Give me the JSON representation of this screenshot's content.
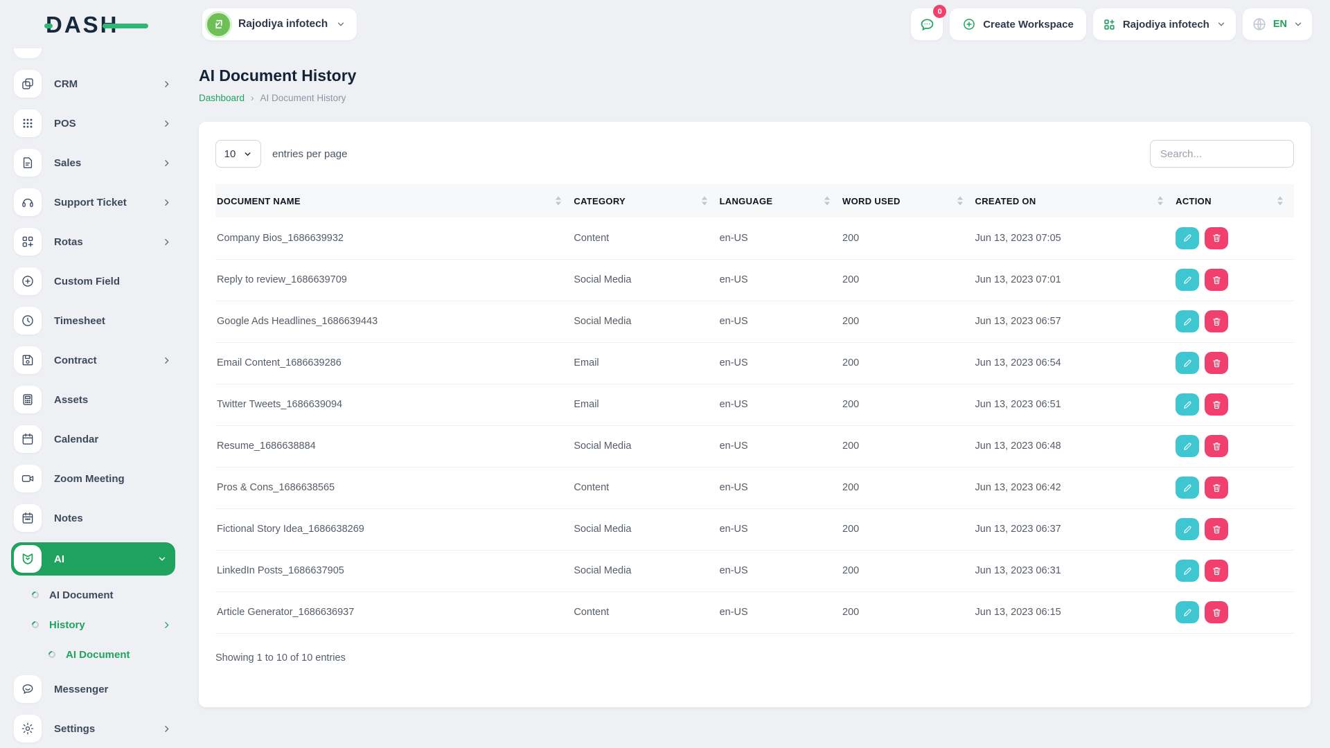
{
  "colors": {
    "primary_green": "#1fa35f",
    "logo_navy": "#16283c",
    "edit_teal": "#3ec7d0",
    "delete_pink": "#f2406e",
    "badge_pink": "#f2406e"
  },
  "topbar": {
    "logo_text": "DASH",
    "workspace_selector": {
      "name": "Rajodiya infotech",
      "icon": "workspace-avatar"
    },
    "messages": {
      "badge_count": "0",
      "icon": "chat-icon"
    },
    "create_workspace": {
      "label": "Create Workspace",
      "icon": "circle-plus-icon"
    },
    "account_selector": {
      "name": "Rajodiya infotech",
      "icon": "grid-plus-icon"
    },
    "language_selector": {
      "code": "EN",
      "icon": "globe-icon"
    }
  },
  "sidebar": {
    "items": [
      {
        "label": "CRM",
        "icon": "crm-icon",
        "has_submenu": true
      },
      {
        "label": "POS",
        "icon": "pos-icon",
        "has_submenu": true
      },
      {
        "label": "Sales",
        "icon": "sales-icon",
        "has_submenu": true
      },
      {
        "label": "Support Ticket",
        "icon": "support-ticket-icon",
        "has_submenu": true
      },
      {
        "label": "Rotas",
        "icon": "rotas-icon",
        "has_submenu": true
      },
      {
        "label": "Custom Field",
        "icon": "custom-field-icon",
        "has_submenu": false
      },
      {
        "label": "Timesheet",
        "icon": "timesheet-icon",
        "has_submenu": false
      },
      {
        "label": "Contract",
        "icon": "contract-icon",
        "has_submenu": true
      },
      {
        "label": "Assets",
        "icon": "assets-icon",
        "has_submenu": false
      },
      {
        "label": "Calendar",
        "icon": "calendar-icon",
        "has_submenu": false
      },
      {
        "label": "Zoom Meeting",
        "icon": "zoom-meeting-icon",
        "has_submenu": false
      },
      {
        "label": "Notes",
        "icon": "notes-icon",
        "has_submenu": false
      },
      {
        "label": "AI",
        "icon": "ai-icon",
        "has_submenu": true,
        "active": true
      },
      {
        "label": "Messenger",
        "icon": "messenger-icon",
        "has_submenu": false
      },
      {
        "label": "Settings",
        "icon": "settings-icon",
        "has_submenu": true
      }
    ],
    "ai_submenu": [
      {
        "label": "AI Document",
        "active": false
      },
      {
        "label": "History",
        "active": true,
        "has_submenu": true
      },
      {
        "label": "AI Document",
        "active": true,
        "nested": true
      }
    ]
  },
  "page": {
    "title": "AI Document History",
    "breadcrumb": {
      "home": "Dashboard",
      "separator": "›",
      "current": "AI Document History"
    }
  },
  "table": {
    "entries_per_page_value": "10",
    "entries_per_page_label": "entries per page",
    "search_placeholder": "Search...",
    "columns": [
      "DOCUMENT NAME",
      "CATEGORY",
      "LANGUAGE",
      "WORD USED",
      "CREATED ON",
      "ACTION"
    ],
    "rows": [
      {
        "name": "Company Bios_1686639932",
        "category": "Content",
        "language": "en-US",
        "words": "200",
        "created": "Jun 13, 2023 07:05"
      },
      {
        "name": "Reply to review_1686639709",
        "category": "Social Media",
        "language": "en-US",
        "words": "200",
        "created": "Jun 13, 2023 07:01"
      },
      {
        "name": "Google Ads Headlines_1686639443",
        "category": "Social Media",
        "language": "en-US",
        "words": "200",
        "created": "Jun 13, 2023 06:57"
      },
      {
        "name": "Email Content_1686639286",
        "category": "Email",
        "language": "en-US",
        "words": "200",
        "created": "Jun 13, 2023 06:54"
      },
      {
        "name": "Twitter Tweets_1686639094",
        "category": "Email",
        "language": "en-US",
        "words": "200",
        "created": "Jun 13, 2023 06:51"
      },
      {
        "name": "Resume_1686638884",
        "category": "Social Media",
        "language": "en-US",
        "words": "200",
        "created": "Jun 13, 2023 06:48"
      },
      {
        "name": "Pros & Cons_1686638565",
        "category": "Content",
        "language": "en-US",
        "words": "200",
        "created": "Jun 13, 2023 06:42"
      },
      {
        "name": "Fictional Story Idea_1686638269",
        "category": "Social Media",
        "language": "en-US",
        "words": "200",
        "created": "Jun 13, 2023 06:37"
      },
      {
        "name": "LinkedIn Posts_1686637905",
        "category": "Social Media",
        "language": "en-US",
        "words": "200",
        "created": "Jun 13, 2023 06:31"
      },
      {
        "name": "Article Generator_1686636937",
        "category": "Content",
        "language": "en-US",
        "words": "200",
        "created": "Jun 13, 2023 06:15"
      }
    ],
    "footer": "Showing 1 to 10 of 10 entries"
  }
}
